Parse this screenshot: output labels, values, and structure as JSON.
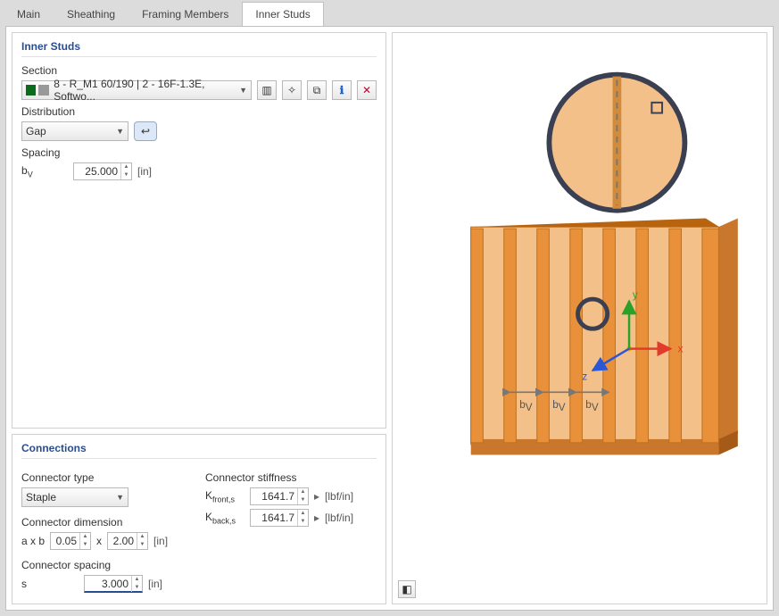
{
  "tabs": [
    "Main",
    "Sheathing",
    "Framing Members",
    "Inner Studs"
  ],
  "active_tab": "Inner Studs",
  "section": {
    "panel_title": "Inner Studs",
    "label": "Section",
    "value": "8 - R_M1 60/190 | 2 - 16F-1.3E, Softwo...",
    "icons": {
      "lib": "library-icon",
      "add": "add-item-icon",
      "copy": "copy-icon",
      "info": "info-icon",
      "del": "delete-icon"
    }
  },
  "distribution": {
    "label": "Distribution",
    "value": "Gap",
    "reset": "reset-icon"
  },
  "spacing": {
    "label": "Spacing",
    "sym": "b",
    "sub": "V",
    "value": "25.000",
    "unit": "[in]"
  },
  "connections": {
    "panel_title": "Connections",
    "type": {
      "label": "Connector type",
      "value": "Staple"
    },
    "dim": {
      "label": "Connector dimension",
      "prefix": "a x b",
      "a": "0.05",
      "x": "x",
      "b": "2.00",
      "unit": "[in]"
    },
    "cspacing": {
      "label": "Connector spacing",
      "sym": "s",
      "value": "3.000",
      "unit": "[in]"
    },
    "stiff": {
      "label": "Connector stiffness",
      "front": {
        "sym": "K",
        "sub": "front,s",
        "value": "1641.7",
        "unit": "[lbf/in]"
      },
      "back": {
        "sym": "K",
        "sub": "back,s",
        "value": "1641.7",
        "unit": "[lbf/in]"
      }
    }
  },
  "scene": {
    "axes": {
      "x": "x",
      "y": "y",
      "z": "z"
    },
    "dim": "b",
    "dimsub": "V"
  }
}
